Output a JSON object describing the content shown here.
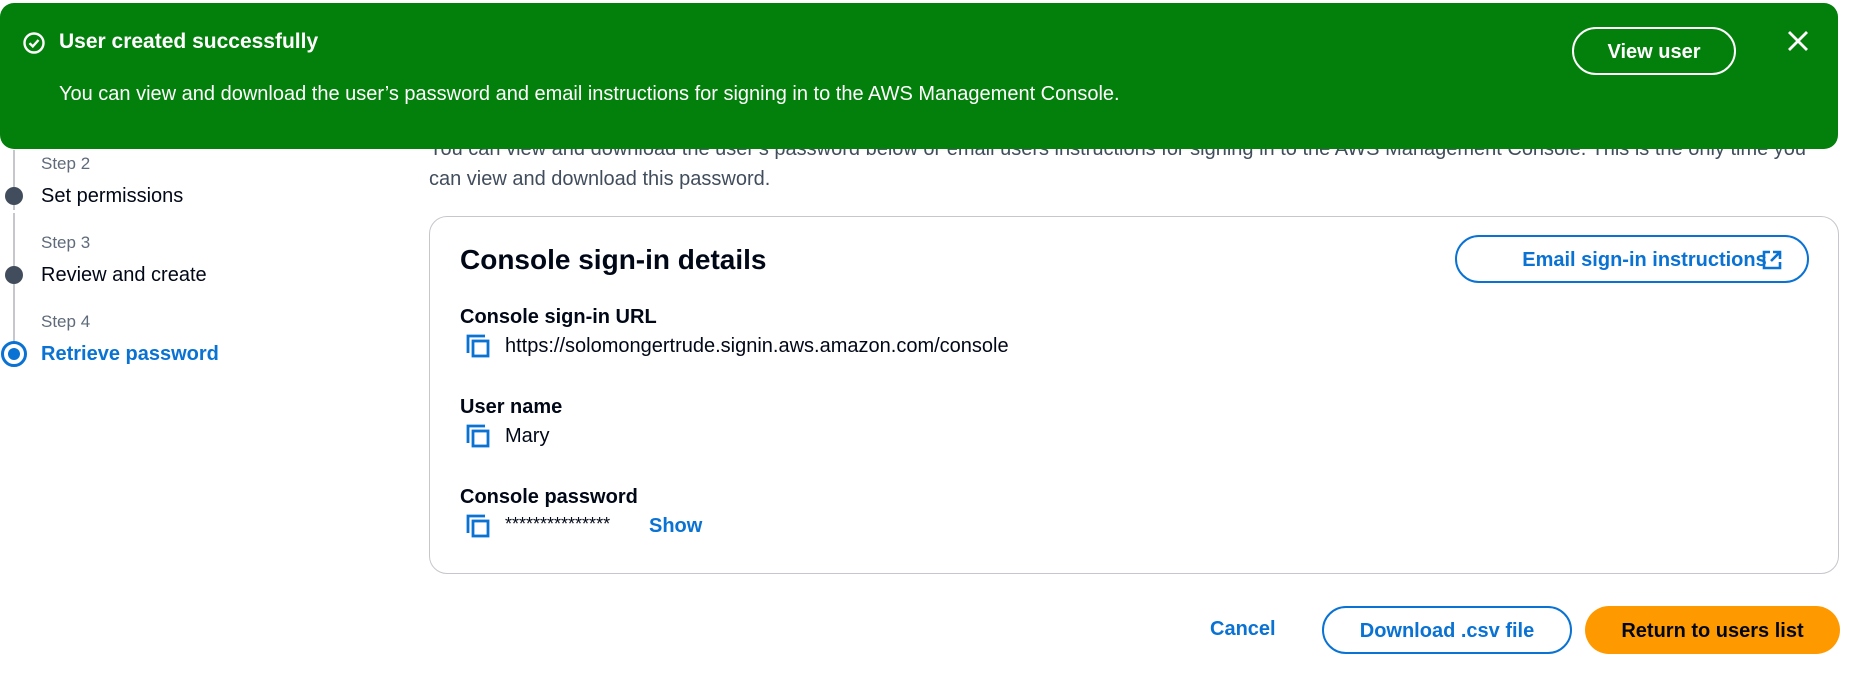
{
  "flash": {
    "title": "User created successfully",
    "message": "You can view and download the user’s password and email instructions for signing in to the AWS Management Console.",
    "view_button": "View user",
    "background_color": "#037f0c",
    "icons": {
      "status": "check-circle-icon",
      "dismiss": "close-icon"
    }
  },
  "steps": [
    {
      "caption": "Step 2",
      "label": "Set permissions",
      "active": false
    },
    {
      "caption": "Step 3",
      "label": "Review and create",
      "active": false
    },
    {
      "caption": "Step 4",
      "label": "Retrieve password",
      "active": true
    }
  ],
  "main": {
    "intro": "You can view and download the user’s password below or email users instructions for signing in to the AWS Management Console. This is the only time you can view and download this password."
  },
  "card": {
    "title": "Console sign-in details",
    "email_button": "Email sign-in instructions",
    "fields": {
      "url": {
        "label": "Console sign-in URL",
        "value": "https://solomongertrude.signin.aws.amazon.com/console"
      },
      "username": {
        "label": "User name",
        "value": "Mary"
      },
      "password": {
        "label": "Console password",
        "value": "***************",
        "show_label": "Show"
      }
    }
  },
  "actions": {
    "cancel": "Cancel",
    "download_csv": "Download .csv file",
    "return": "Return to users list"
  },
  "colors": {
    "link": "#0972d3",
    "primary_button": "#ff9900",
    "success": "#037f0c"
  }
}
